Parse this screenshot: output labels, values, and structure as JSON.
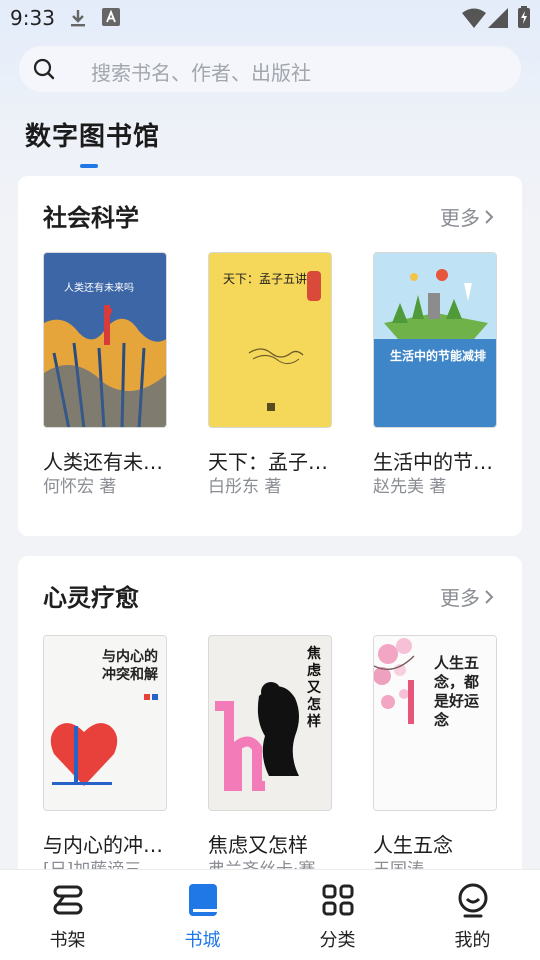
{
  "status_bar": {
    "time": "9:33"
  },
  "search": {
    "placeholder": "搜索书名、作者、出版社"
  },
  "page": {
    "title": "数字图书馆"
  },
  "sections": [
    {
      "title": "社会科学",
      "more_label": "更多",
      "books": [
        {
          "title": "人类还有未…",
          "author": "何怀宏 著",
          "cover_text": "人类还有未来吗",
          "cover_color": "#3d67a8"
        },
        {
          "title": "天下：孟子…",
          "author": "白彤东 著",
          "cover_text": "天下：孟子五讲",
          "cover_color": "#f5d75a"
        },
        {
          "title": "生活中的节…",
          "author": "赵先美 著",
          "cover_text": "生活中的节能减排",
          "cover_color": "#3f86c8"
        }
      ]
    },
    {
      "title": "心灵疗愈",
      "more_label": "更多",
      "books": [
        {
          "title": "与内心的冲…",
          "author": "[日]加藤谛三",
          "cover_text": "与内心的冲突和解",
          "cover_color": "#f6f6f4"
        },
        {
          "title": "焦虑又怎样",
          "author": "弗兰齐丝卡·赛…",
          "cover_text": "焦虑又怎样",
          "cover_color": "#f1efeb"
        },
        {
          "title": "人生五念",
          "author": "王国涛",
          "cover_text": "人生五念，都是好运念",
          "cover_color": "#fbfbfb"
        }
      ]
    }
  ],
  "bottom_nav": [
    {
      "label": "书架",
      "icon": "bookshelf-icon",
      "active": false
    },
    {
      "label": "书城",
      "icon": "book-store-icon",
      "active": true
    },
    {
      "label": "分类",
      "icon": "category-grid-icon",
      "active": false
    },
    {
      "label": "我的",
      "icon": "profile-icon",
      "active": false
    }
  ],
  "colors": {
    "accent": "#1f78e6"
  }
}
